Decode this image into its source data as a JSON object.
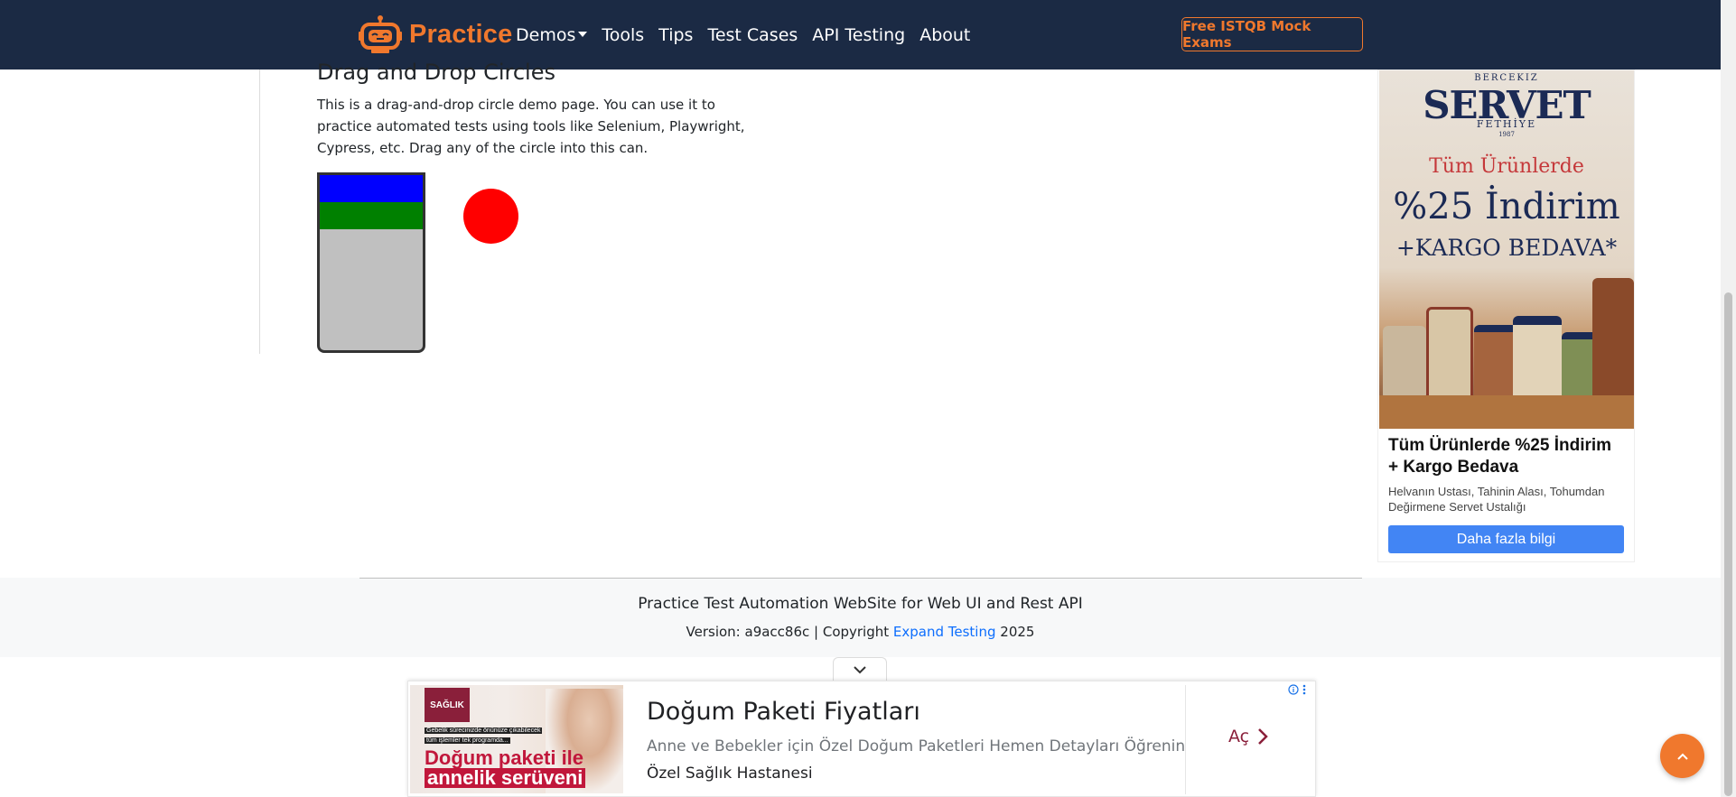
{
  "navbar": {
    "brand_text": "Practice",
    "links": [
      "Demos",
      "Tools",
      "Tips",
      "Test Cases",
      "API Testing",
      "About"
    ],
    "mock_exam_button": "Free ISTQB Mock Exams",
    "colors": {
      "background": "#1b2a44",
      "accent": "#f0782d"
    }
  },
  "main": {
    "title": "Drag and Drop Circles",
    "description": "This is a drag-and-drop circle demo page. You can use it to practice automated tests using tools like Selenium, Playwright, Cypress, etc. Drag any of the circle into this can.",
    "can_bands": [
      {
        "name": "blue",
        "color": "#0000ff"
      },
      {
        "name": "green",
        "color": "#008000"
      }
    ],
    "circles": [
      {
        "name": "red",
        "color": "#ff0000"
      }
    ]
  },
  "side_ad": {
    "image_text": {
      "brand_small": "BERCEKIZ",
      "brand_big": "SERVET",
      "brand_sub": "FETHİYE",
      "brand_year": "1987",
      "promo_line1": "Tüm Ürünlerde",
      "promo_line2": "%25 İndirim",
      "promo_line3": "+KARGO BEDAVA*"
    },
    "headline": "Tüm Ürünlerde %25 İndirim + Kargo Bedava",
    "body": "Helvanın Ustası, Tahinin Alası, Tohumdan Değirmene Servet Ustalığı",
    "cta": "Daha fazla bilgi",
    "cta_color": "#4285f4"
  },
  "footer": {
    "title": "Practice Test Automation WebSite for Web UI and Rest API",
    "version_prefix": "Version: a9acc86c | Copyright ",
    "company_link": "Expand Testing",
    "year": " 2025"
  },
  "bottom_ad": {
    "image_text": {
      "logo": "SAĞLIK",
      "tag1": "Gebelik sürecinizde önünüze çıkabilecek",
      "tag2": "tüm işlemler tek programda...",
      "title1": "Doğum paketi ile",
      "title2": "annelik serüveni"
    },
    "title": "Doğum Paketi Fiyatları",
    "description": "Anne ve Bebekler için Özel Doğum Paketleri Hemen Detayları Öğrenin",
    "sponsor": "Özel Sağlık Hastanesi",
    "cta": "Aç"
  }
}
